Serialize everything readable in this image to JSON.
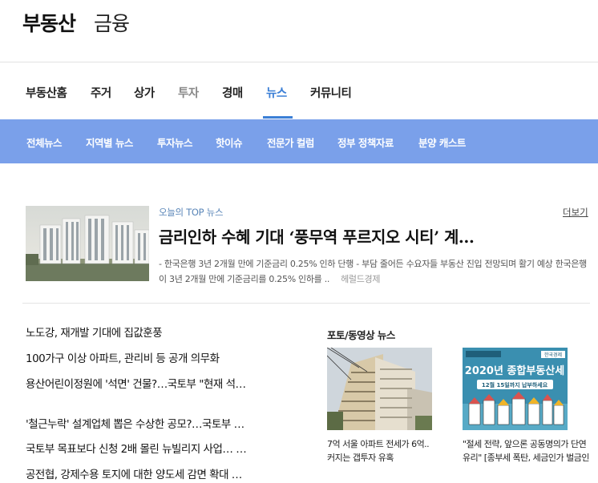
{
  "header": {
    "brand": "부동산",
    "section": "금융"
  },
  "main_nav": {
    "items": [
      "부동산홈",
      "주거",
      "상가",
      "투자",
      "경매",
      "뉴스",
      "커뮤니티"
    ],
    "active": "뉴스"
  },
  "sub_nav": {
    "items": [
      "전체뉴스",
      "지역별 뉴스",
      "투자뉴스",
      "핫이슈",
      "전문가 컬럼",
      "정부 정책자료",
      "분양 캐스트"
    ]
  },
  "top_news": {
    "label": "오늘의 TOP 뉴스",
    "more": "더보기",
    "headline": "금리인하 수혜 기대 ‘풍무역 푸르지오 시티’ 계…",
    "summary": "- 한국은행 3년 2개월 만에 기준금리 0.25% 인하 단행 - 부담 줄어든 수요자들 부동산 진입 전망되며 활기 예상   한국은행이 3년 2개월 만에 기준금리를 0.25% 인하를 ..",
    "source": "헤럴드경제"
  },
  "news_list": [
    "노도강, 재개발 기대에 집값훈풍",
    "100가구 이상 아파트, 관리비 등 공개 의무화",
    "용산어린이정원에 '석면' 건물?…국토부 \"현재 석…",
    "'철근누락' 설계업체 뽑은 수상한 공모?…국토부 …",
    "국토부 목표보다 신청 2배 몰린 뉴빌리지 사업… …",
    "공전협, 강제수용 토지에 대한 양도세 감면 확대 …"
  ],
  "photo_section": {
    "title": "포토/동영상 뉴스",
    "items": [
      {
        "caption": "7억 서울 아파트 전세가 6억.. 커지는 갭투자 유혹"
      },
      {
        "caption": "\"절세 전략, 앞으론 공동명의가 단연 유리\" [종부세 폭탄, 세금인가 벌금인가]",
        "image_text": {
          "banner": "2020년 종합부동산세",
          "notice": "12월 15일까지 납부하세요",
          "corner": "한국경제"
        }
      }
    ]
  },
  "colors": {
    "accent": "#3b7fd6",
    "subnav_bg": "#7aa0ea",
    "top_label": "#5a86b8"
  }
}
